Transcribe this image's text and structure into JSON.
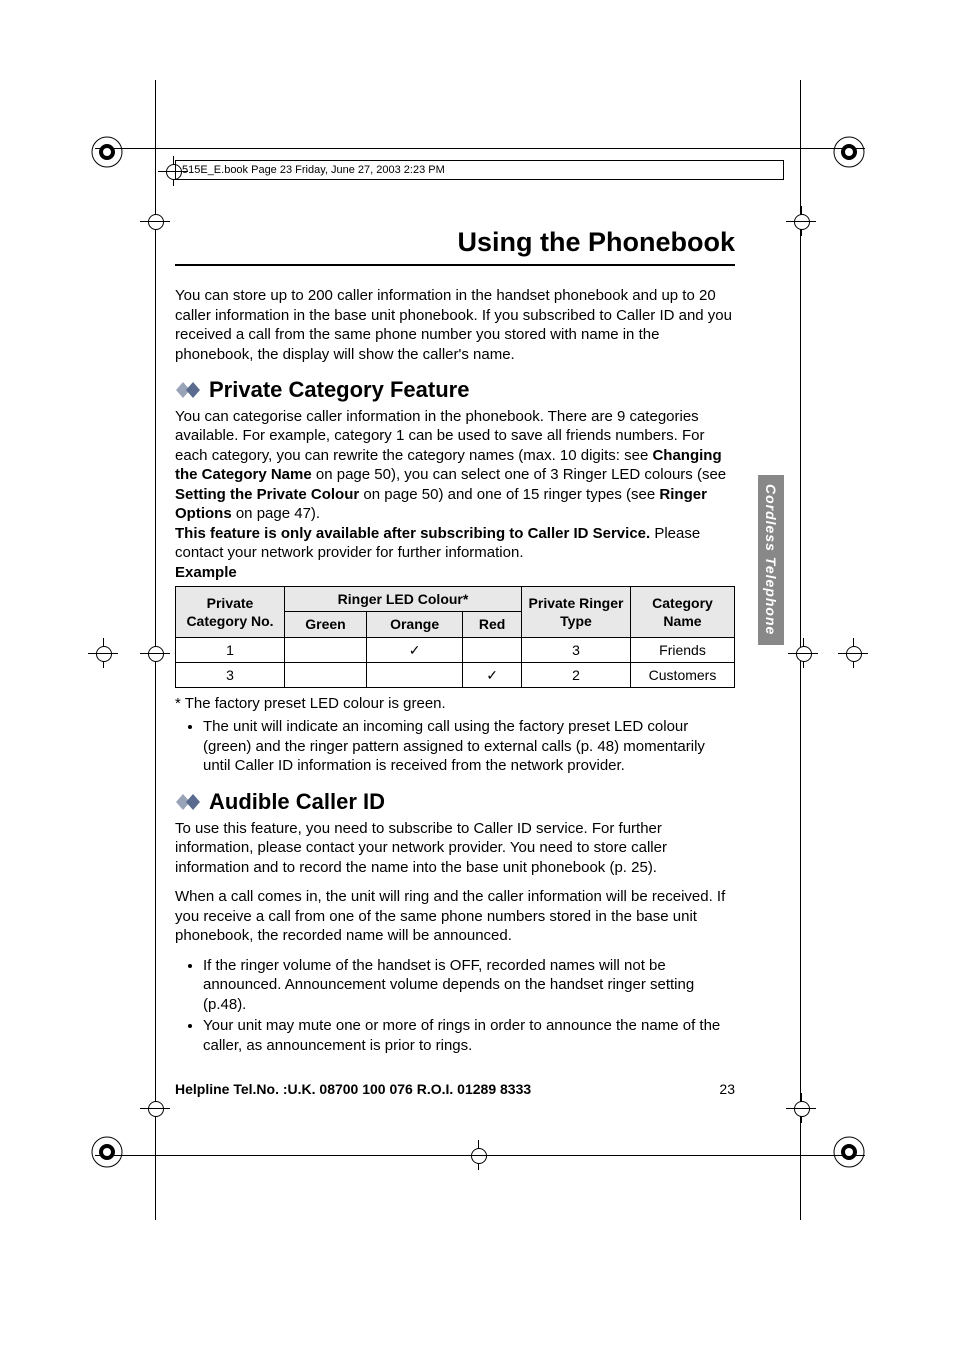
{
  "printer_header": "515E_E.book  Page 23  Friday, June 27, 2003  2:23 PM",
  "page_title": "Using the Phonebook",
  "intro": "You can store up to 200 caller information in the handset phonebook  and up to 20 caller information in the base unit phonebook. If you subscribed to Caller ID and you received a call from the same phone number you stored with name in the phonebook, the display will show the caller's name.",
  "sections": {
    "private": {
      "title": "Private Category Feature",
      "body1": "You can categorise caller information in the phonebook. There are 9 categories available. For example, category 1 can be used to save all friends numbers. For each category, you can rewrite the category names (max. 10 digits: see ",
      "xref1": "Changing the Category Name",
      "body2": " on page 50), you can select one of 3 Ringer LED colours (see ",
      "xref2": "Setting the Private Colour",
      "body3": " on page 50) and one of 15 ringer types (see ",
      "xref3": "Ringer Options",
      "body4": " on page 47).",
      "bold_note": "This feature is only available after subscribing to Caller ID Service.",
      "body5": " Please contact your network provider for further information.",
      "example_label": "Example",
      "footnote_star": "* The factory preset LED colour is green.",
      "bullet": "The unit will indicate an incoming call using the factory preset LED colour (green) and the ringer pattern assigned to external calls (p. 48) momentarily until Caller ID information is received from the network provider."
    },
    "audible": {
      "title": "Audible Caller ID",
      "body1": "To use this feature, you need to subscribe to Caller ID service. For further information, please contact your network provider. You need to store caller information and to record the name into the base unit phonebook (p. 25).",
      "body2": "When a call comes in, the unit will ring and the caller information will be received. If you receive a call from one of the same phone numbers stored in the base unit phonebook, the recorded name will be announced.",
      "bullet1": "If the ringer volume of the handset is OFF, recorded names will not be announced. Announcement volume depends on the handset ringer setting (p.48).",
      "bullet2": "Your unit may mute one or more of rings in order to announce the name of the caller, as announcement is prior to rings."
    }
  },
  "table": {
    "headers": {
      "private_cat": "Private Category No.",
      "ringer_colour": "Ringer LED Colour*",
      "green": "Green",
      "orange": "Orange",
      "red": "Red",
      "ringer_type": "Private Ringer Type",
      "cat_name": "Category Name"
    },
    "rows": [
      {
        "cat": "1",
        "green": "",
        "orange": "✓",
        "red": "",
        "ringer": "3",
        "name": "Friends"
      },
      {
        "cat": "3",
        "green": "",
        "orange": "",
        "red": "✓",
        "ringer": "2",
        "name": "Customers"
      }
    ]
  },
  "side_tab": "Cordless Telephone",
  "footer": {
    "helpline": "Helpline Tel.No. :U.K. 08700 100 076  R.O.I. 01289 8333",
    "page": "23"
  }
}
